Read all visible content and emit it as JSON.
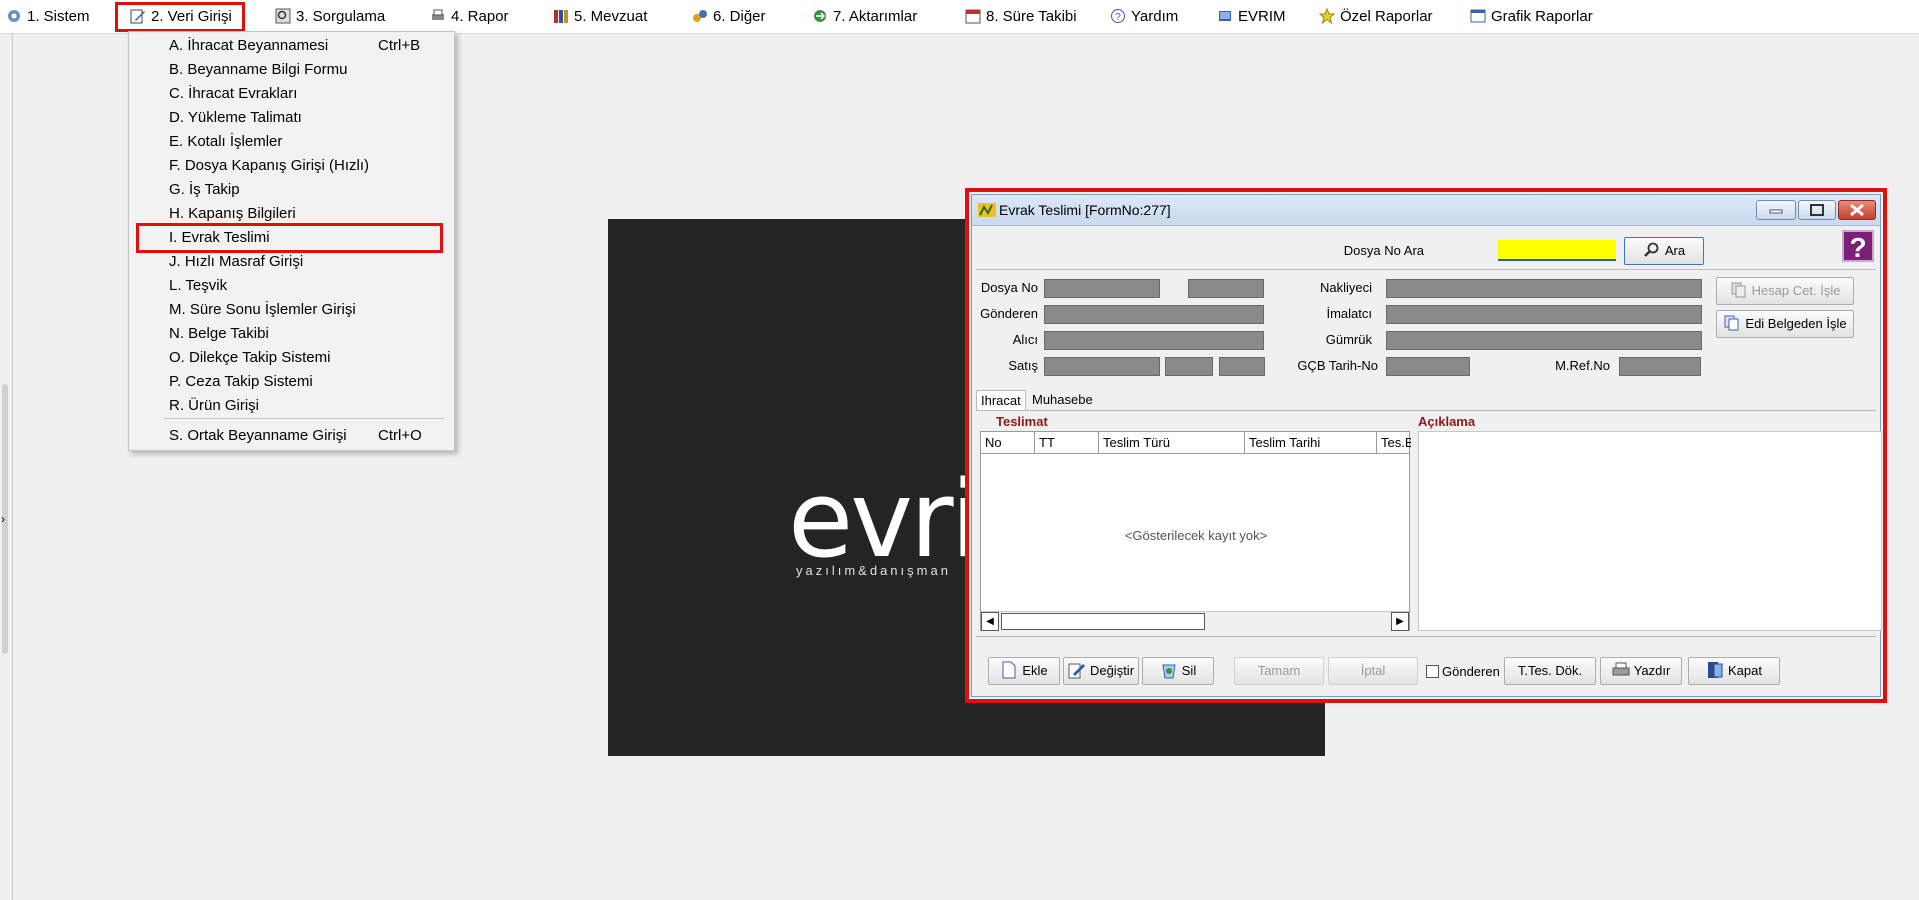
{
  "menubar": {
    "items": [
      {
        "label": "1.  Sistem"
      },
      {
        "label": "2.  Veri Girişi"
      },
      {
        "label": "3.  Sorgulama"
      },
      {
        "label": "4.  Rapor"
      },
      {
        "label": "5.  Mevzuat"
      },
      {
        "label": "6.  Diğer"
      },
      {
        "label": "7.  Aktarımlar"
      },
      {
        "label": "8. Süre Takibi"
      },
      {
        "label": "Yardım"
      },
      {
        "label": "EVRIM"
      },
      {
        "label": "Özel Raporlar"
      },
      {
        "label": "Grafik Raporlar"
      }
    ]
  },
  "dropdown": {
    "items": [
      {
        "label": "A.  İhracat Beyannamesi",
        "shortcut": "Ctrl+B"
      },
      {
        "label": "B.  Beyanname Bilgi Formu",
        "shortcut": ""
      },
      {
        "label": "C.  İhracat Evrakları",
        "shortcut": ""
      },
      {
        "label": "D.  Yükleme Talimatı",
        "shortcut": ""
      },
      {
        "label": "E.  Kotalı İşlemler",
        "shortcut": ""
      },
      {
        "label": "F.  Dosya Kapanış Girişi (Hızlı)",
        "shortcut": ""
      },
      {
        "label": "G.  İş Takip",
        "shortcut": ""
      },
      {
        "label": "H.  Kapanış Bilgileri",
        "shortcut": ""
      },
      {
        "label": "I.  Evrak Teslimi",
        "shortcut": ""
      },
      {
        "label": "J.  Hızlı Masraf Girişi",
        "shortcut": ""
      },
      {
        "label": "L.  Teşvik",
        "shortcut": ""
      },
      {
        "label": "M.  Süre Sonu İşlemler Girişi",
        "shortcut": ""
      },
      {
        "label": "N.  Belge Takibi",
        "shortcut": ""
      },
      {
        "label": "O.  Dilekçe Takip Sistemi",
        "shortcut": ""
      },
      {
        "label": "P.  Ceza Takip Sistemi",
        "shortcut": ""
      },
      {
        "label": "R.  Ürün Girişi",
        "shortcut": ""
      },
      {
        "label": "S.  Ortak Beyanname Girişi",
        "shortcut": "Ctrl+O"
      }
    ]
  },
  "splash": {
    "logo": "evri",
    "tagline": "yazılım&danışman"
  },
  "window": {
    "title": "Evrak Teslimi [FormNo:277]",
    "help": "?",
    "search_label": "Dosya No Ara",
    "search_value": "",
    "search_button": "Ara",
    "fields": {
      "dosya_no": "Dosya No",
      "gonderen": "Gönderen",
      "alici": "Alıcı",
      "satis": "Satış",
      "nakliyeci": "Nakliyeci",
      "imalatci": "İmalatcı",
      "gumruk": "Gümrük",
      "gcb": "GÇB Tarih-No",
      "mref": "M.Ref.No"
    },
    "hesap_btn": "Hesap Cet. İşle",
    "edi_btn": "Edi Belgeden İşle",
    "tabs": [
      "Ihracat",
      "Muhasebe"
    ],
    "teslimat_title": "Teslimat",
    "aciklama_title": "Açıklama",
    "columns": [
      "No",
      "TT",
      "Teslim Türü",
      "Teslim Tarihi",
      "Tes.B"
    ],
    "empty_text": "<Gösterilecek kayıt yok>",
    "buttons": {
      "ekle": "Ekle",
      "degistir": "Değiştir",
      "sil": "Sil",
      "tamam": "Tamam",
      "iptal": "İptal",
      "gonderen": "Gönderen",
      "ttes": "T.Tes. Dök.",
      "yazdir": "Yazdır",
      "kapat": "Kapat"
    }
  },
  "colors": {
    "highlight": "#e01010",
    "search_field": "#ffff00",
    "section_title": "#8a1a1a"
  }
}
